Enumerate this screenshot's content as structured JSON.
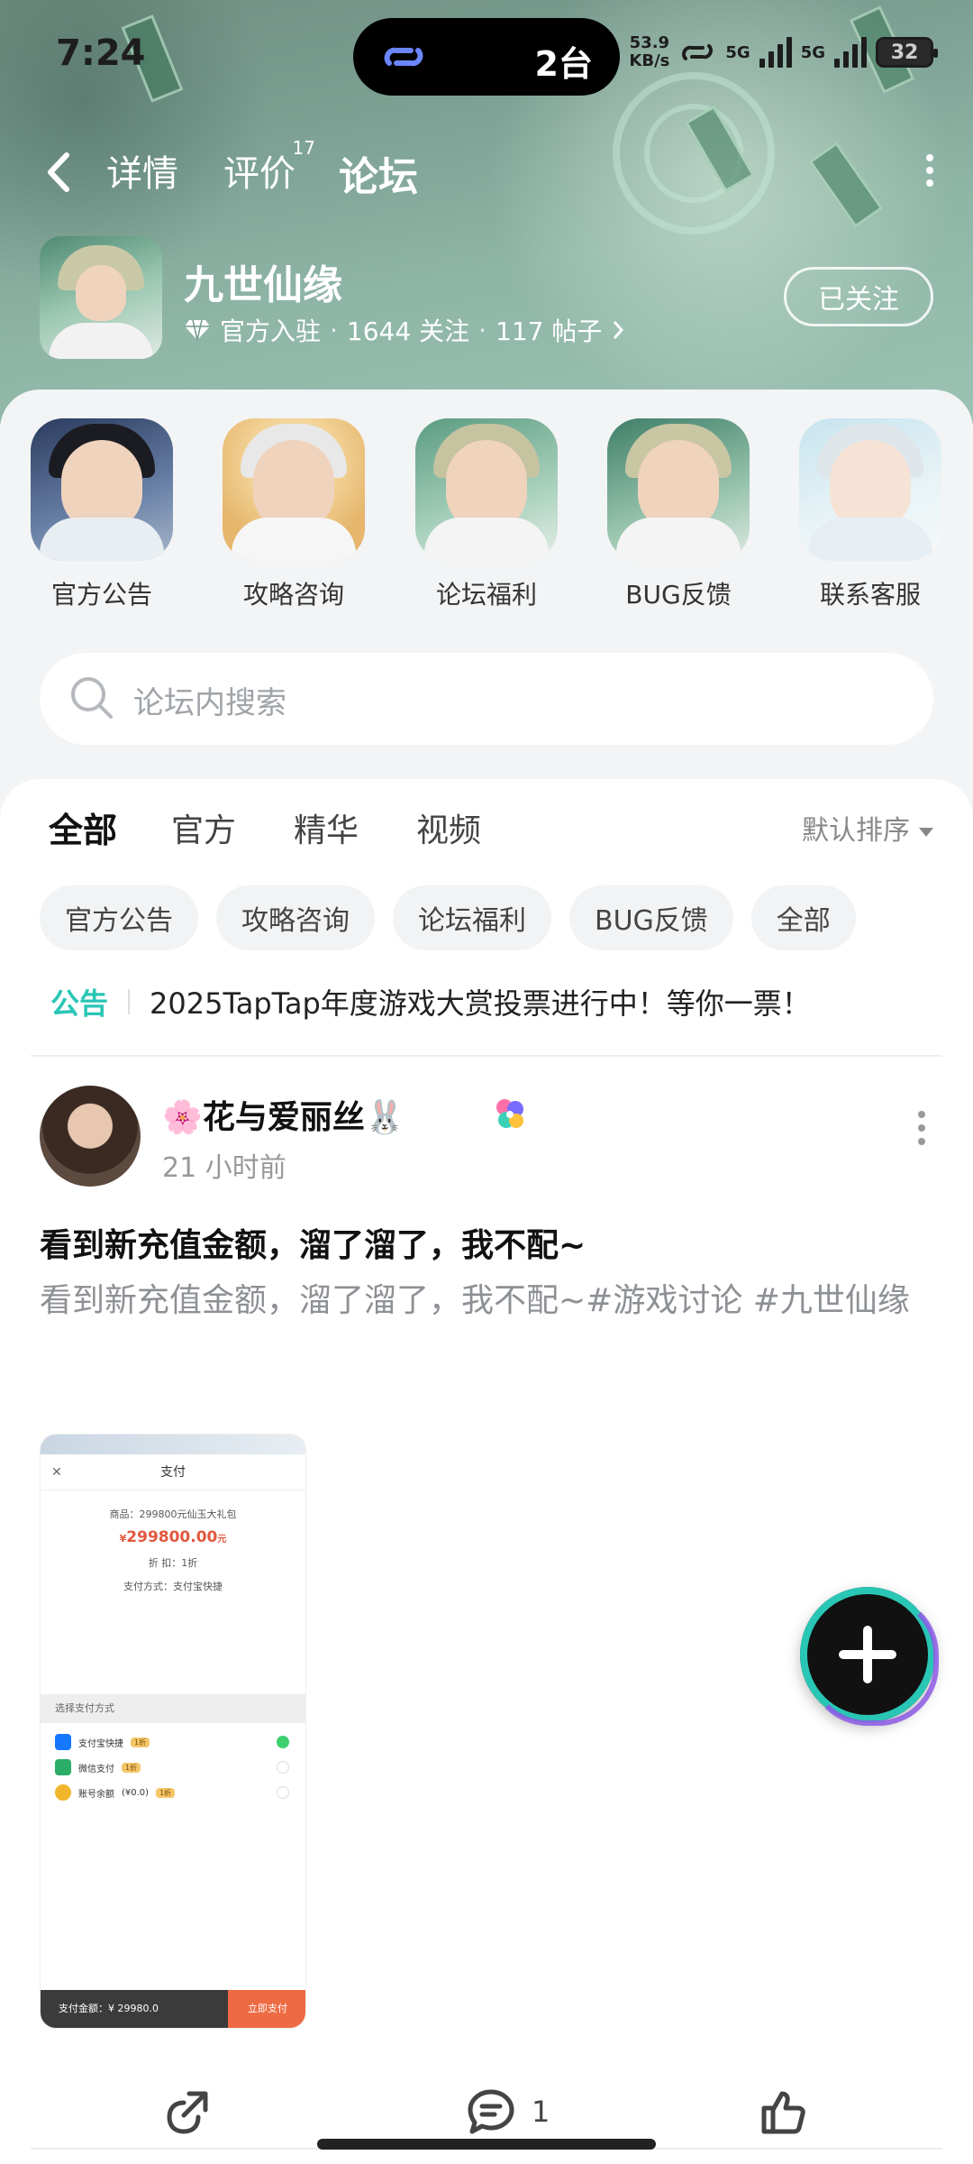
{
  "status_bar": {
    "time": "7:24",
    "island_label": "2台",
    "net_speed_value": "53.9",
    "net_speed_unit": "KB/s",
    "net1": "5G",
    "net2": "5G",
    "battery": "32"
  },
  "nav": {
    "tabs": [
      {
        "label": "详情"
      },
      {
        "label": "评价",
        "badge": "17"
      },
      {
        "label": "论坛"
      }
    ],
    "active_tab": "论坛"
  },
  "game": {
    "name": "九世仙缘",
    "official": "官方入驻",
    "followers": "1644 关注",
    "posts": "117 帖子",
    "follow_button": "已关注"
  },
  "shortcuts": [
    {
      "label": "官方公告"
    },
    {
      "label": "攻略咨询"
    },
    {
      "label": "论坛福利"
    },
    {
      "label": "BUG反馈"
    },
    {
      "label": "联系客服"
    }
  ],
  "search": {
    "placeholder": "论坛内搜索"
  },
  "feed_tabs": [
    {
      "label": "全部"
    },
    {
      "label": "官方"
    },
    {
      "label": "精华"
    },
    {
      "label": "视频"
    }
  ],
  "sort_label": "默认排序",
  "chips": [
    "官方公告",
    "攻略咨询",
    "论坛福利",
    "BUG反馈",
    "全部"
  ],
  "notice": {
    "tag": "公告",
    "text": "2025TapTap年度游戏大赏投票进行中！等你一票！"
  },
  "post": {
    "author": "🌸花与爱丽丝🐰",
    "time": "21 小时前",
    "title": "看到新充值金额，溜了溜了，我不配~",
    "body": "看到新充值金额，溜了溜了，我不配~#游戏讨论 #九世仙缘",
    "comment_count": "1",
    "image": {
      "header": "支付",
      "product": "商品：299800元仙玉大礼包",
      "amount_symbol": "¥",
      "amount": "299800.00",
      "amount_unit": "元",
      "discount": "折 扣：1折",
      "method": "支付方式：支付宝快捷",
      "select_title": "选择支付方式",
      "options": [
        "支付宝快捷",
        "微信支付",
        "账号余额"
      ],
      "balance": "(¥0.0)",
      "option_tag": "1折",
      "footer_total": "支付金额：¥ 29980.0",
      "footer_button": "立即支付"
    }
  },
  "colors": {
    "accent": "#29c6b5",
    "hero": "#7fa396",
    "price": "#e2583e"
  },
  "icons": [
    "back-icon",
    "more-icon",
    "diamond-icon",
    "search-icon",
    "share-icon",
    "comment-icon",
    "like-icon",
    "plus-icon"
  ]
}
